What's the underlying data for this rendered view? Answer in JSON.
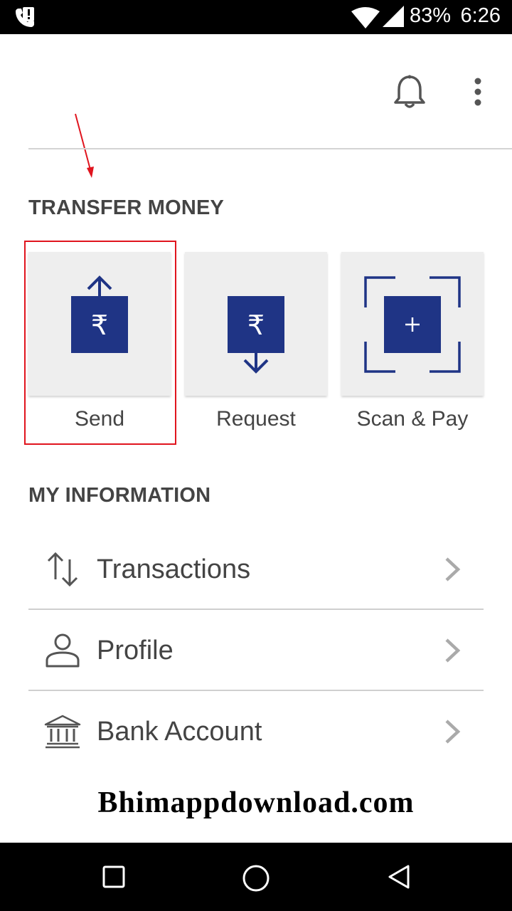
{
  "status_bar": {
    "battery": "83%",
    "time": "6:26",
    "icons": [
      "phone-wifi-call-icon",
      "alert-notification-icon",
      "wifi-icon",
      "signal-icon",
      "battery-icon"
    ]
  },
  "app_bar": {
    "icons": [
      "bell-icon",
      "overflow-menu-icon"
    ]
  },
  "transfer": {
    "title": "TRANSFER MONEY",
    "tiles": [
      {
        "label": "Send",
        "icon": "send-money-icon"
      },
      {
        "label": "Request",
        "icon": "request-money-icon"
      },
      {
        "label": "Scan & Pay",
        "icon": "scan-pay-icon"
      }
    ]
  },
  "info": {
    "title": "MY INFORMATION",
    "items": [
      {
        "label": "Transactions",
        "icon": "transactions-icon"
      },
      {
        "label": "Profile",
        "icon": "profile-icon"
      },
      {
        "label": "Bank Account",
        "icon": "bank-icon"
      }
    ]
  },
  "watermark": "Bhimappdownload.com",
  "colors": {
    "accent_navy": "#1f3485",
    "annotation_red": "#e0141e",
    "tile_bg": "#eeeeee",
    "text_gray": "#444444"
  },
  "nav_bar": {
    "icons": [
      "recents-square-icon",
      "home-circle-icon",
      "back-triangle-icon"
    ]
  }
}
